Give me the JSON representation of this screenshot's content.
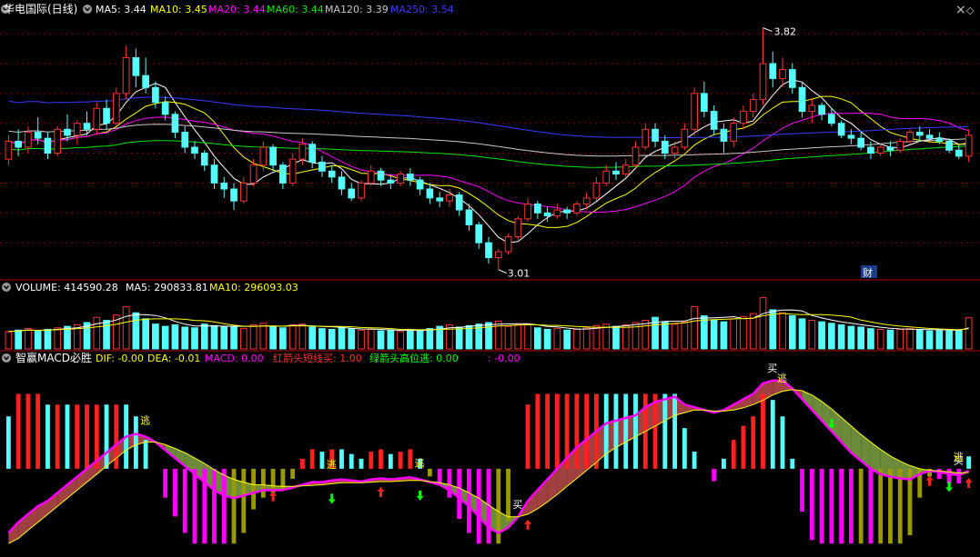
{
  "colors": {
    "bg": "#000000",
    "grid": "#8b0000",
    "up": "#ff3232",
    "down": "#54fcfc",
    "ma5": "#ffffff",
    "ma10": "#ffff00",
    "ma20": "#ff00ff",
    "ma60": "#00e600",
    "ma120": "#c8c8c8",
    "ma250": "#3a3aff",
    "dif": "#ff00ff",
    "dea": "#ffff00",
    "fill_up": "#a04040",
    "fill_down": "#6b8a3a",
    "bar_pos_a": "#ff2020",
    "bar_pos_b": "#54fcfc",
    "bar_neg_a": "#ff00ff",
    "bar_neg_b": "#9a9a00",
    "buy_arrow": "#ff2020",
    "sell_arrow": "#00ff00",
    "signal_text": "#ffffff",
    "escape_text": "#ffff00"
  },
  "price_panel": {
    "stock": "华电国际(日线)",
    "ma5": "MA5: 3.44",
    "ma10": "MA10: 3.45",
    "ma20": "MA20: 3.44",
    "ma60": "MA60: 3.44",
    "ma120": "MA120: 3.39",
    "ma250": "MA250: 3.54",
    "high_label": "3.82",
    "low_label": "3.01",
    "finance_mark": "财",
    "close_icon": "×",
    "diamond_icon": "◇"
  },
  "volume_panel": {
    "volume": "VOLUME: 414590.28",
    "ma5": "MA5: 290833.81",
    "ma10": "MA10: 296093.03"
  },
  "macd_panel": {
    "name": "智赢MACD必胜",
    "dif": "DIF: -0.00",
    "dea": "DEA: -0.01",
    "macd": "MACD: 0.00",
    "red_arrow": "红箭头短线买: 1.00",
    "green_arrow": "绿箭头高位逃: 0.00",
    "extra": ": -0.00",
    "buy_text": "买",
    "escape_text": "逃"
  },
  "chart_data": {
    "type": "candlestick",
    "price_range": [
      3.0,
      3.84
    ],
    "price_grid": [
      3.1,
      3.2,
      3.3,
      3.4,
      3.5,
      3.6,
      3.7,
      3.8
    ],
    "candles": [
      [
        3.38,
        3.46,
        3.36,
        3.44
      ],
      [
        3.44,
        3.48,
        3.39,
        3.42
      ],
      [
        3.42,
        3.49,
        3.4,
        3.47
      ],
      [
        3.47,
        3.52,
        3.43,
        3.45
      ],
      [
        3.45,
        3.47,
        3.38,
        3.4
      ],
      [
        3.4,
        3.49,
        3.39,
        3.48
      ],
      [
        3.48,
        3.53,
        3.44,
        3.46
      ],
      [
        3.46,
        3.51,
        3.43,
        3.5
      ],
      [
        3.5,
        3.54,
        3.46,
        3.48
      ],
      [
        3.48,
        3.57,
        3.46,
        3.55
      ],
      [
        3.55,
        3.58,
        3.48,
        3.5
      ],
      [
        3.5,
        3.62,
        3.49,
        3.6
      ],
      [
        3.6,
        3.76,
        3.58,
        3.72
      ],
      [
        3.72,
        3.75,
        3.62,
        3.66
      ],
      [
        3.66,
        3.72,
        3.6,
        3.62
      ],
      [
        3.62,
        3.64,
        3.55,
        3.57
      ],
      [
        3.57,
        3.59,
        3.51,
        3.53
      ],
      [
        3.53,
        3.54,
        3.45,
        3.47
      ],
      [
        3.47,
        3.49,
        3.4,
        3.42
      ],
      [
        3.42,
        3.44,
        3.38,
        3.4
      ],
      [
        3.4,
        3.41,
        3.34,
        3.36
      ],
      [
        3.36,
        3.38,
        3.28,
        3.3
      ],
      [
        3.3,
        3.32,
        3.25,
        3.28
      ],
      [
        3.28,
        3.3,
        3.21,
        3.24
      ],
      [
        3.24,
        3.32,
        3.23,
        3.3
      ],
      [
        3.3,
        3.38,
        3.29,
        3.36
      ],
      [
        3.36,
        3.44,
        3.34,
        3.42
      ],
      [
        3.42,
        3.43,
        3.34,
        3.36
      ],
      [
        3.36,
        3.37,
        3.28,
        3.3
      ],
      [
        3.3,
        3.4,
        3.29,
        3.38
      ],
      [
        3.38,
        3.45,
        3.36,
        3.43
      ],
      [
        3.43,
        3.44,
        3.35,
        3.37
      ],
      [
        3.37,
        3.39,
        3.32,
        3.34
      ],
      [
        3.34,
        3.36,
        3.3,
        3.32
      ],
      [
        3.32,
        3.34,
        3.26,
        3.28
      ],
      [
        3.28,
        3.3,
        3.24,
        3.25
      ],
      [
        3.25,
        3.31,
        3.24,
        3.3
      ],
      [
        3.3,
        3.36,
        3.29,
        3.34
      ],
      [
        3.34,
        3.35,
        3.29,
        3.31
      ],
      [
        3.31,
        3.33,
        3.28,
        3.3
      ],
      [
        3.3,
        3.34,
        3.29,
        3.33
      ],
      [
        3.33,
        3.35,
        3.29,
        3.31
      ],
      [
        3.31,
        3.32,
        3.26,
        3.28
      ],
      [
        3.28,
        3.3,
        3.23,
        3.25
      ],
      [
        3.25,
        3.27,
        3.22,
        3.24
      ],
      [
        3.24,
        3.28,
        3.22,
        3.26
      ],
      [
        3.26,
        3.27,
        3.19,
        3.21
      ],
      [
        3.21,
        3.23,
        3.14,
        3.16
      ],
      [
        3.16,
        3.17,
        3.08,
        3.1
      ],
      [
        3.1,
        3.12,
        3.03,
        3.05
      ],
      [
        3.05,
        3.08,
        3.01,
        3.07
      ],
      [
        3.07,
        3.13,
        3.06,
        3.12
      ],
      [
        3.12,
        3.19,
        3.11,
        3.18
      ],
      [
        3.18,
        3.25,
        3.17,
        3.23
      ],
      [
        3.23,
        3.24,
        3.18,
        3.2
      ],
      [
        3.2,
        3.22,
        3.17,
        3.19
      ],
      [
        3.19,
        3.23,
        3.18,
        3.21
      ],
      [
        3.21,
        3.22,
        3.18,
        3.2
      ],
      [
        3.2,
        3.24,
        3.19,
        3.23
      ],
      [
        3.23,
        3.27,
        3.21,
        3.25
      ],
      [
        3.25,
        3.32,
        3.24,
        3.3
      ],
      [
        3.3,
        3.36,
        3.29,
        3.34
      ],
      [
        3.34,
        3.37,
        3.31,
        3.33
      ],
      [
        3.33,
        3.38,
        3.32,
        3.36
      ],
      [
        3.36,
        3.44,
        3.35,
        3.42
      ],
      [
        3.42,
        3.5,
        3.41,
        3.48
      ],
      [
        3.48,
        3.5,
        3.42,
        3.44
      ],
      [
        3.44,
        3.46,
        3.38,
        3.4
      ],
      [
        3.4,
        3.44,
        3.38,
        3.42
      ],
      [
        3.42,
        3.5,
        3.41,
        3.48
      ],
      [
        3.48,
        3.62,
        3.46,
        3.6
      ],
      [
        3.6,
        3.64,
        3.52,
        3.54
      ],
      [
        3.54,
        3.56,
        3.46,
        3.48
      ],
      [
        3.48,
        3.5,
        3.4,
        3.44
      ],
      [
        3.44,
        3.52,
        3.42,
        3.5
      ],
      [
        3.5,
        3.56,
        3.48,
        3.54
      ],
      [
        3.54,
        3.6,
        3.52,
        3.58
      ],
      [
        3.58,
        3.82,
        3.56,
        3.7
      ],
      [
        3.7,
        3.74,
        3.62,
        3.65
      ],
      [
        3.65,
        3.72,
        3.62,
        3.68
      ],
      [
        3.68,
        3.7,
        3.6,
        3.62
      ],
      [
        3.62,
        3.64,
        3.52,
        3.54
      ],
      [
        3.54,
        3.58,
        3.5,
        3.56
      ],
      [
        3.56,
        3.57,
        3.51,
        3.53
      ],
      [
        3.53,
        3.55,
        3.49,
        3.5
      ],
      [
        3.5,
        3.51,
        3.45,
        3.46
      ],
      [
        3.46,
        3.48,
        3.43,
        3.45
      ],
      [
        3.45,
        3.47,
        3.41,
        3.42
      ],
      [
        3.42,
        3.44,
        3.38,
        3.4
      ],
      [
        3.4,
        3.43,
        3.39,
        3.42
      ],
      [
        3.42,
        3.44,
        3.39,
        3.41
      ],
      [
        3.41,
        3.45,
        3.4,
        3.44
      ],
      [
        3.44,
        3.48,
        3.43,
        3.47
      ],
      [
        3.47,
        3.49,
        3.44,
        3.46
      ],
      [
        3.46,
        3.48,
        3.44,
        3.45
      ],
      [
        3.45,
        3.47,
        3.43,
        3.44
      ],
      [
        3.44,
        3.45,
        3.4,
        3.41
      ],
      [
        3.41,
        3.43,
        3.38,
        3.39
      ],
      [
        3.39,
        3.48,
        3.37,
        3.46
      ]
    ],
    "volume_range": [
      0,
      700000
    ],
    "volumes": [
      230000,
      250000,
      270000,
      240000,
      260000,
      280000,
      300000,
      320000,
      350000,
      420000,
      380000,
      450000,
      560000,
      480000,
      400000,
      330000,
      300000,
      320000,
      290000,
      280000,
      330000,
      310000,
      300000,
      290000,
      270000,
      320000,
      340000,
      300000,
      280000,
      320000,
      330000,
      290000,
      270000,
      260000,
      280000,
      270000,
      250000,
      260000,
      240000,
      250000,
      230000,
      260000,
      250000,
      270000,
      300000,
      320000,
      290000,
      310000,
      330000,
      350000,
      370000,
      300000,
      320000,
      330000,
      280000,
      260000,
      270000,
      250000,
      260000,
      280000,
      310000,
      330000,
      300000,
      320000,
      350000,
      380000,
      420000,
      360000,
      330000,
      360000,
      560000,
      440000,
      380000,
      360000,
      400000,
      430000,
      470000,
      680000,
      520000,
      480000,
      440000,
      400000,
      380000,
      360000,
      340000,
      320000,
      300000,
      290000,
      270000,
      260000,
      250000,
      260000,
      270000,
      260000,
      240000,
      250000,
      240000,
      250000,
      414590
    ],
    "macd_range": [
      -0.16,
      0.18
    ],
    "dif": [
      -0.12,
      -0.1,
      -0.085,
      -0.07,
      -0.06,
      -0.045,
      -0.03,
      -0.015,
      0.0,
      0.015,
      0.03,
      0.045,
      0.06,
      0.065,
      0.06,
      0.05,
      0.035,
      0.02,
      0.005,
      -0.01,
      -0.025,
      -0.04,
      -0.05,
      -0.055,
      -0.05,
      -0.045,
      -0.04,
      -0.04,
      -0.04,
      -0.035,
      -0.03,
      -0.025,
      -0.025,
      -0.022,
      -0.02,
      -0.022,
      -0.024,
      -0.02,
      -0.018,
      -0.02,
      -0.018,
      -0.016,
      -0.02,
      -0.025,
      -0.03,
      -0.04,
      -0.055,
      -0.07,
      -0.09,
      -0.11,
      -0.12,
      -0.11,
      -0.09,
      -0.06,
      -0.04,
      -0.02,
      0.0,
      0.02,
      0.04,
      0.055,
      0.07,
      0.085,
      0.09,
      0.095,
      0.1,
      0.115,
      0.125,
      0.13,
      0.135,
      0.12,
      0.115,
      0.11,
      0.105,
      0.11,
      0.12,
      0.13,
      0.14,
      0.16,
      0.165,
      0.165,
      0.15,
      0.13,
      0.11,
      0.09,
      0.07,
      0.05,
      0.03,
      0.015,
      0.0,
      -0.01,
      -0.015,
      -0.018,
      -0.02,
      -0.01,
      -0.004,
      -0.006,
      -0.01,
      -0.012,
      -0.004
    ],
    "dea": [
      -0.14,
      -0.13,
      -0.115,
      -0.1,
      -0.085,
      -0.07,
      -0.055,
      -0.04,
      -0.025,
      -0.01,
      0.005,
      0.02,
      0.035,
      0.045,
      0.05,
      0.05,
      0.045,
      0.038,
      0.03,
      0.02,
      0.01,
      -0.002,
      -0.012,
      -0.02,
      -0.025,
      -0.03,
      -0.03,
      -0.032,
      -0.033,
      -0.033,
      -0.032,
      -0.031,
      -0.03,
      -0.028,
      -0.026,
      -0.026,
      -0.026,
      -0.025,
      -0.024,
      -0.024,
      -0.023,
      -0.022,
      -0.022,
      -0.024,
      -0.026,
      -0.03,
      -0.036,
      -0.045,
      -0.055,
      -0.068,
      -0.08,
      -0.09,
      -0.09,
      -0.085,
      -0.075,
      -0.062,
      -0.048,
      -0.033,
      -0.018,
      -0.003,
      0.012,
      0.028,
      0.04,
      0.05,
      0.06,
      0.07,
      0.08,
      0.09,
      0.1,
      0.105,
      0.11,
      0.11,
      0.108,
      0.108,
      0.11,
      0.114,
      0.12,
      0.128,
      0.138,
      0.145,
      0.148,
      0.146,
      0.138,
      0.126,
      0.112,
      0.096,
      0.08,
      0.064,
      0.05,
      0.036,
      0.024,
      0.014,
      0.006,
      0.0,
      -0.003,
      -0.004,
      -0.006,
      -0.008,
      -0.007
    ],
    "buy_markers": [
      52,
      78,
      97
    ],
    "escape_markers": [],
    "green_arrows": [
      33,
      42,
      84,
      96
    ],
    "red_arrows": [
      27,
      38,
      53,
      94,
      98
    ]
  }
}
